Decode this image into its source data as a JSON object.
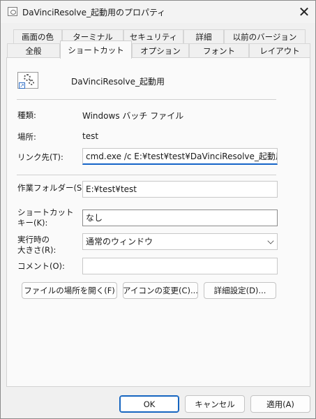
{
  "window": {
    "title": "DaVinciResolve_起動用のプロパティ"
  },
  "tabs_row1": [
    "画面の色",
    "ターミナル",
    "セキュリティ",
    "詳細",
    "以前のバージョン"
  ],
  "tabs_row2": [
    "全般",
    "ショートカット",
    "オプション",
    "フォント",
    "レイアウト"
  ],
  "shortcut": {
    "name": "DaVinciResolve_起動用"
  },
  "fields": {
    "type_label": "種類:",
    "type_value": "Windows バッチ ファイル",
    "location_label": "場所:",
    "location_value": "test",
    "target_label": "リンク先(T):",
    "target_value": "cmd.exe /c E:¥test¥test¥DaVinciResolve_起動用.bat",
    "workdir_label": "作業フォルダー(S):",
    "workdir_value": "E:¥test¥test",
    "hotkey_label_1": "ショートカット",
    "hotkey_label_2": "キー(K):",
    "hotkey_value": "なし",
    "run_label_1": "実行時の",
    "run_label_2": "大きさ(R):",
    "run_value": "通常のウィンドウ",
    "comment_label": "コメント(O):",
    "comment_value": ""
  },
  "action_buttons": {
    "open_location": "ファイルの場所を開く(F)",
    "change_icon": "アイコンの変更(C)...",
    "advanced": "詳細設定(D)..."
  },
  "dialog_buttons": {
    "ok": "OK",
    "cancel": "キャンセル",
    "apply": "適用(A)"
  },
  "colors": {
    "accent": "#1565c0",
    "window_bg": "#f0f0f0",
    "panel_bg": "#fafafa"
  },
  "icons": {
    "title": "shortcut-app-icon",
    "close": "close-icon",
    "shortcut": "gears-icon",
    "dropdown": "chevron-down-icon"
  }
}
